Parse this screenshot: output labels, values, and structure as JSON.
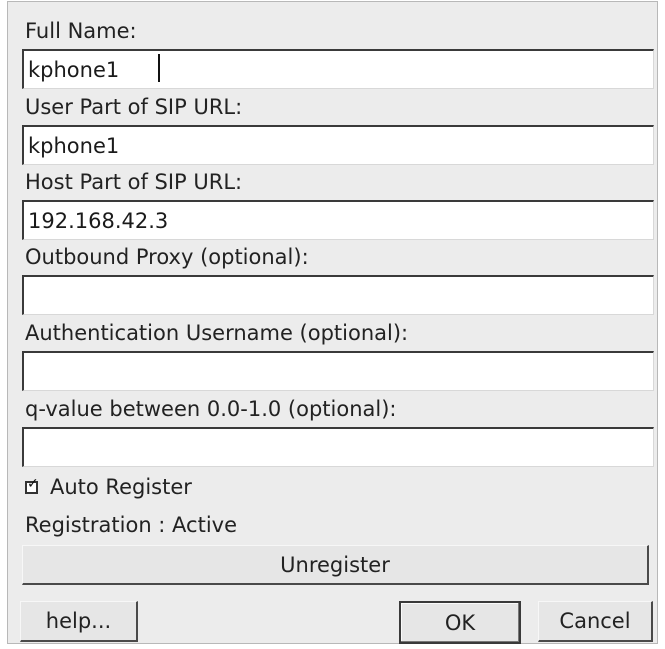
{
  "fields": [
    {
      "label": "Full Name:",
      "value": "kphone1"
    },
    {
      "label": "User Part of SIP URL:",
      "value": "kphone1"
    },
    {
      "label": "Host Part of SIP URL:",
      "value": "192.168.42.3"
    },
    {
      "label": "Outbound Proxy (optional):",
      "value": ""
    },
    {
      "label": "Authentication Username (optional):",
      "value": ""
    },
    {
      "label": "q-value between 0.0-1.0 (optional):",
      "value": ""
    }
  ],
  "auto_register": {
    "label": "Auto Register",
    "checked": true,
    "mark": "✓"
  },
  "registration_status": "Registration : Active",
  "buttons": {
    "unregister": "Unregister",
    "help": "help...",
    "ok": "OK",
    "cancel": "Cancel"
  }
}
